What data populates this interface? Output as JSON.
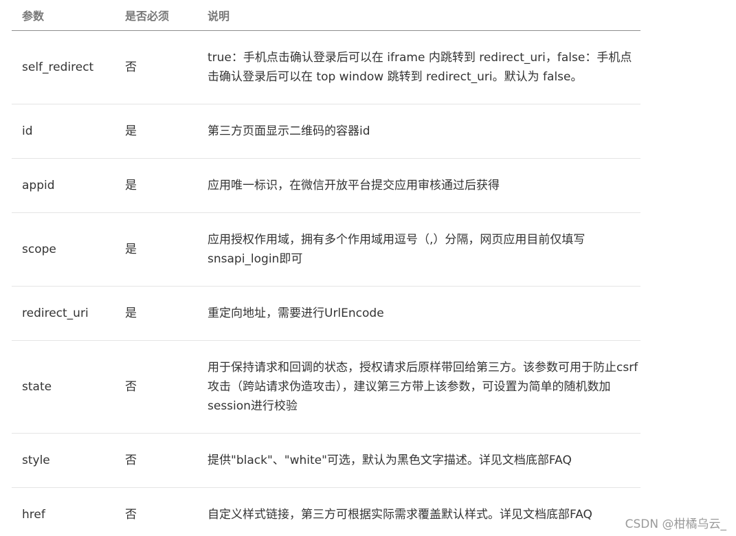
{
  "table": {
    "headers": {
      "param": "参数",
      "required": "是否必须",
      "description": "说明"
    },
    "rows": [
      {
        "param": "self_redirect",
        "required": "否",
        "description": "true：手机点击确认登录后可以在 iframe 内跳转到 redirect_uri，false：手机点击确认登录后可以在 top window 跳转到 redirect_uri。默认为 false。"
      },
      {
        "param": "id",
        "required": "是",
        "description": "第三方页面显示二维码的容器id"
      },
      {
        "param": "appid",
        "required": "是",
        "description": "应用唯一标识，在微信开放平台提交应用审核通过后获得"
      },
      {
        "param": "scope",
        "required": "是",
        "description": "应用授权作用域，拥有多个作用域用逗号（,）分隔，网页应用目前仅填写snsapi_login即可"
      },
      {
        "param": "redirect_uri",
        "required": "是",
        "description": "重定向地址，需要进行UrlEncode"
      },
      {
        "param": "state",
        "required": "否",
        "description": "用于保持请求和回调的状态，授权请求后原样带回给第三方。该参数可用于防止csrf攻击（跨站请求伪造攻击），建议第三方带上该参数，可设置为简单的随机数加session进行校验"
      },
      {
        "param": "style",
        "required": "否",
        "description": "提供\"black\"、\"white\"可选，默认为黑色文字描述。详见文档底部FAQ"
      },
      {
        "param": "href",
        "required": "否",
        "description": "自定义样式链接，第三方可根据实际需求覆盖默认样式。详见文档底部FAQ"
      }
    ]
  },
  "watermark": "CSDN @柑橘乌云_"
}
